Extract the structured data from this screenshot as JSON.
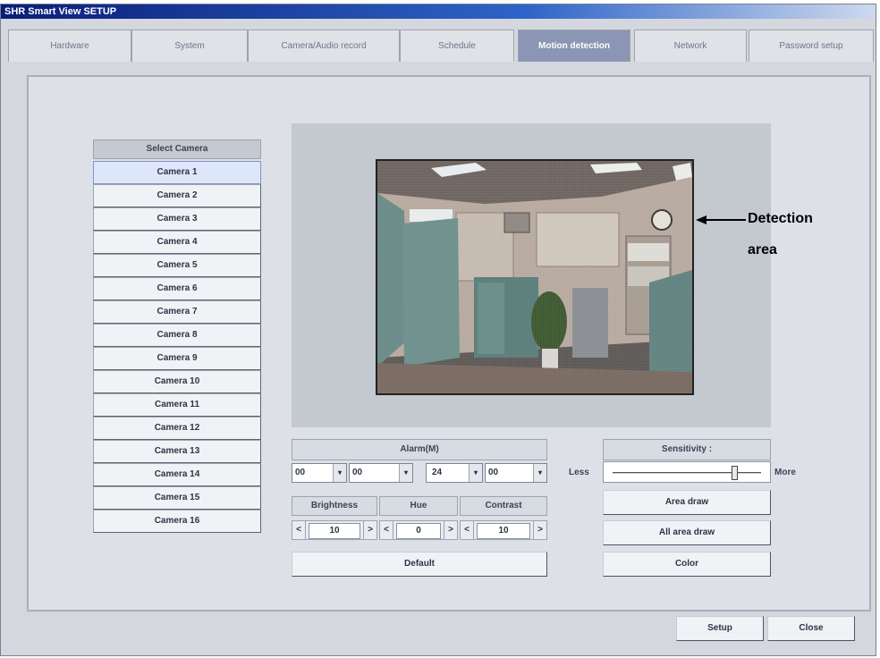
{
  "window": {
    "title": "SHR Smart View SETUP"
  },
  "tabs": [
    {
      "label": "Hardware"
    },
    {
      "label": "System"
    },
    {
      "label": "Camera/Audio record"
    },
    {
      "label": "Schedule"
    },
    {
      "label": "Motion detection",
      "active": true
    },
    {
      "label": "Network"
    },
    {
      "label": "Password setup"
    }
  ],
  "cameras": {
    "header": "Select Camera",
    "selected_index": 0,
    "items": [
      "Camera 1",
      "Camera 2",
      "Camera 3",
      "Camera 4",
      "Camera 5",
      "Camera 6",
      "Camera 7",
      "Camera 8",
      "Camera 9",
      "Camera 10",
      "Camera 11",
      "Camera 12",
      "Camera 13",
      "Camera 14",
      "Camera 15",
      "Camera 16"
    ]
  },
  "annotation": {
    "line1": "Detection",
    "line2": "area"
  },
  "alarm": {
    "header": "Alarm(M)",
    "start_hour": "00",
    "start_min": "00",
    "end_hour": "24",
    "end_min": "00",
    "arrow": "▾"
  },
  "image": {
    "brightness_label": "Brightness",
    "hue_label": "Hue",
    "contrast_label": "Contrast",
    "brightness_value": "10",
    "hue_value": "0",
    "contrast_value": "10",
    "dec": "<",
    "inc": ">",
    "default_label": "Default"
  },
  "sensitivity": {
    "header": "Sensitivity :",
    "less_label": "Less",
    "more_label": "More",
    "level_fraction": 0.82
  },
  "buttons": {
    "area_draw": "Area draw",
    "all_area_draw": "All area draw",
    "color": "Color",
    "setup": "Setup",
    "close": "Close"
  },
  "colors": {
    "active_tab": "#8b96b4",
    "title_bar": "#0a1e78"
  }
}
